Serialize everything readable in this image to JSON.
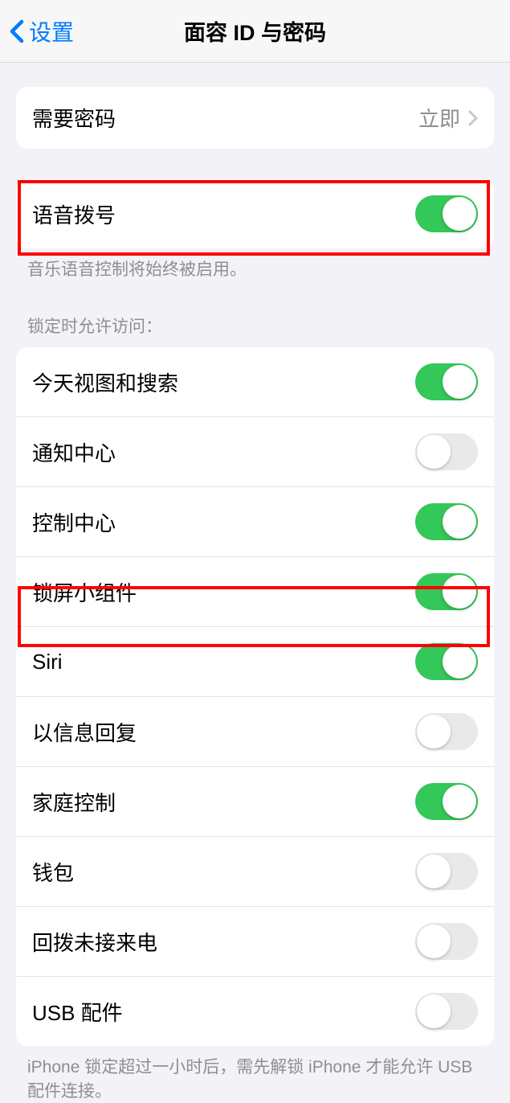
{
  "header": {
    "back_label": "设置",
    "title": "面容 ID 与密码"
  },
  "require_passcode": {
    "label": "需要密码",
    "value": "立即"
  },
  "voice_dial": {
    "label": "语音拨号",
    "enabled": true,
    "footer": "音乐语音控制将始终被启用。"
  },
  "locked_access": {
    "header": "锁定时允许访问：",
    "items": [
      {
        "label": "今天视图和搜索",
        "enabled": true
      },
      {
        "label": "通知中心",
        "enabled": false
      },
      {
        "label": "控制中心",
        "enabled": true
      },
      {
        "label": "锁屏小组件",
        "enabled": true
      },
      {
        "label": "Siri",
        "enabled": true
      },
      {
        "label": "以信息回复",
        "enabled": false
      },
      {
        "label": "家庭控制",
        "enabled": true
      },
      {
        "label": "钱包",
        "enabled": false
      },
      {
        "label": "回拨未接来电",
        "enabled": false
      },
      {
        "label": "USB 配件",
        "enabled": false
      }
    ],
    "footer": "iPhone 锁定超过一小时后，需先解锁 iPhone 才能允许 USB 配件连接。"
  },
  "colors": {
    "accent": "#007aff",
    "toggle_on": "#34c759",
    "toggle_off": "#e9e9eb",
    "highlight": "#ff0000",
    "background": "#f2f2f7"
  }
}
